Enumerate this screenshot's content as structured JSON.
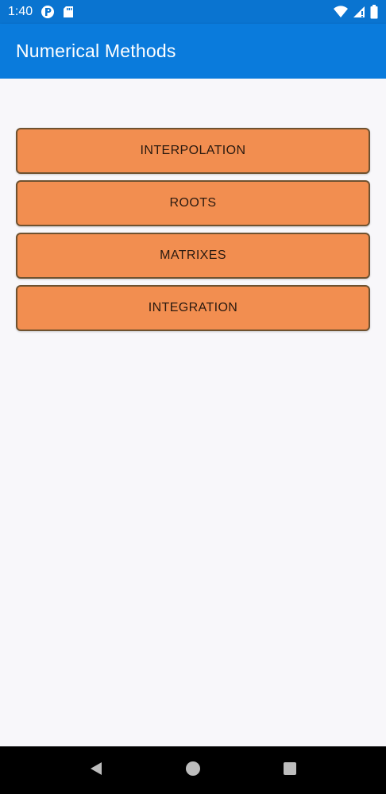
{
  "status_bar": {
    "time": "1:40",
    "icons": [
      "record-icon",
      "sd-card-icon",
      "wifi-icon",
      "signal-icon",
      "battery-icon"
    ]
  },
  "app_bar": {
    "title": "Numerical Methods",
    "color": "#0a7bdc"
  },
  "buttons": [
    {
      "label": "INTERPOLATION"
    },
    {
      "label": "ROOTS"
    },
    {
      "label": "MATRIXES"
    },
    {
      "label": "INTEGRATION"
    }
  ],
  "button_color": "#f28e50",
  "nav_bar": {
    "icons": [
      "back-icon",
      "home-icon",
      "recents-icon"
    ]
  }
}
